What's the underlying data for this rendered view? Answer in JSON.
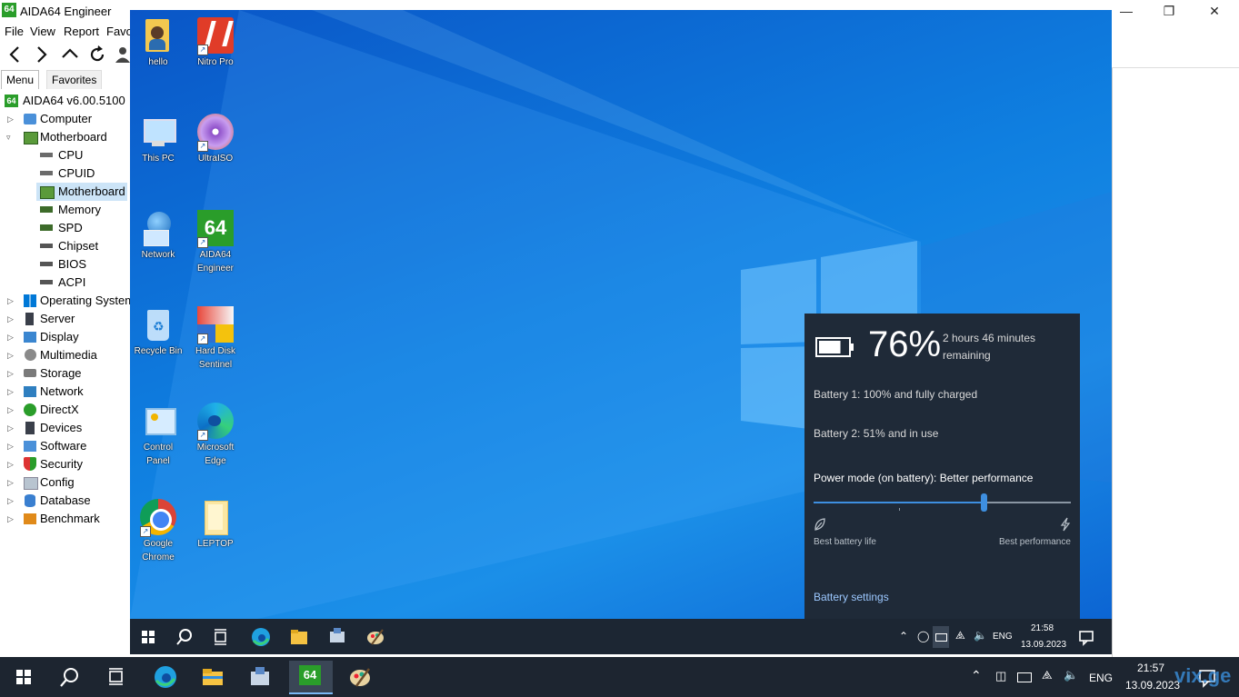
{
  "window": {
    "app_icon_text": "64",
    "title": "AIDA64 Engineer",
    "controls": {
      "minimize": "—",
      "restore": "❐",
      "close": "✕"
    }
  },
  "menu": [
    "File",
    "View",
    "Report",
    "Favo"
  ],
  "toolbar": [
    "back-icon",
    "forward-icon",
    "up-icon",
    "refresh-icon",
    "user-icon"
  ],
  "tabs": {
    "menu": "Menu",
    "favorites": "Favorites"
  },
  "tree": {
    "root": {
      "label": "AIDA64 v6.00.5100",
      "badge": "64"
    },
    "items": [
      {
        "label": "Computer",
        "icon": "computer-icon",
        "expanded": false
      },
      {
        "label": "Motherboard",
        "icon": "motherboard-icon",
        "expanded": true,
        "children": [
          {
            "label": "CPU",
            "icon": "cpu-icon"
          },
          {
            "label": "CPUID",
            "icon": "cpu-icon"
          },
          {
            "label": "Motherboard",
            "icon": "motherboard-icon",
            "selected": true
          },
          {
            "label": "Memory",
            "icon": "memory-icon"
          },
          {
            "label": "SPD",
            "icon": "memory-icon"
          },
          {
            "label": "Chipset",
            "icon": "chip-icon"
          },
          {
            "label": "BIOS",
            "icon": "chip-icon"
          },
          {
            "label": "ACPI",
            "icon": "chip-icon"
          }
        ]
      },
      {
        "label": "Operating System",
        "icon": "windows-icon"
      },
      {
        "label": "Server",
        "icon": "server-icon"
      },
      {
        "label": "Display",
        "icon": "display-icon"
      },
      {
        "label": "Multimedia",
        "icon": "multimedia-icon"
      },
      {
        "label": "Storage",
        "icon": "storage-icon"
      },
      {
        "label": "Network",
        "icon": "network-icon"
      },
      {
        "label": "DirectX",
        "icon": "directx-icon"
      },
      {
        "label": "Devices",
        "icon": "devices-icon"
      },
      {
        "label": "Software",
        "icon": "software-icon"
      },
      {
        "label": "Security",
        "icon": "security-icon"
      },
      {
        "label": "Config",
        "icon": "config-icon"
      },
      {
        "label": "Database",
        "icon": "database-icon"
      },
      {
        "label": "Benchmark",
        "icon": "benchmark-icon"
      }
    ]
  },
  "desktop": {
    "icons": [
      {
        "label": "hello",
        "icon": "user-folder-icon"
      },
      {
        "label": "Nitro Pro",
        "icon": "nitro-pro-icon"
      },
      {
        "label": "This PC",
        "icon": "this-pc-icon"
      },
      {
        "label": "UltraISO",
        "icon": "ultraiso-icon"
      },
      {
        "label": "Network",
        "icon": "network-globe-icon"
      },
      {
        "label": "AIDA64 Engineer",
        "icon": "aida64-icon",
        "badge": "64"
      },
      {
        "label": "Recycle Bin",
        "icon": "recycle-bin-icon"
      },
      {
        "label": "Hard Disk Sentinel",
        "icon": "hard-disk-sentinel-icon"
      },
      {
        "label": "Control Panel",
        "icon": "control-panel-icon"
      },
      {
        "label": "Microsoft Edge",
        "icon": "edge-icon"
      },
      {
        "label": "Google Chrome",
        "icon": "chrome-icon"
      },
      {
        "label": "LEPTOP",
        "icon": "folder-icon"
      }
    ],
    "shortcut_glyph": "↗"
  },
  "battery": {
    "percent": "76%",
    "level": 0.76,
    "remaining": "2 hours 46 minutes remaining",
    "battery1": "Battery 1: 100% and fully charged",
    "battery2": "Battery 2: 51% and in use",
    "power_mode": "Power mode (on battery): Better performance",
    "slider_value": 0.66,
    "best_battery": "Best battery life",
    "best_performance": "Best performance",
    "settings_link": "Battery settings"
  },
  "inner_taskbar": {
    "lang": "ENG",
    "time": "21:58",
    "date": "13.09.2023"
  },
  "host_taskbar": {
    "lang": "ENG",
    "time": "21:57",
    "date": "13.09.2023",
    "aida_badge": "64"
  },
  "watermark": "vix.ge"
}
